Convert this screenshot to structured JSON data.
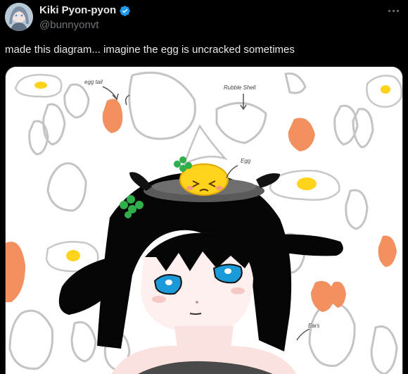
{
  "author": {
    "display_name": "Kiki Pyon-pyon",
    "handle": "@bunnyonvt",
    "verified": true
  },
  "post": {
    "text": "made this diagram... imagine the egg is uncracked sometimes"
  },
  "drawing": {
    "annotations": {
      "egg_tail": "egg tail",
      "rubble_shell": "Rubble Shell",
      "egg_label": "Egg",
      "ears": "Ears"
    }
  },
  "icons": {
    "verified": "verified-badge-icon",
    "more": "more-options-icon"
  },
  "colors": {
    "background": "#000000",
    "text_primary": "#e7e9ea",
    "text_secondary": "#71767b",
    "verified_blue": "#1d9bf0",
    "egg_yolk": "#ffd21c",
    "shell_orange": "#f2905f",
    "clover_green": "#2fae4b"
  }
}
